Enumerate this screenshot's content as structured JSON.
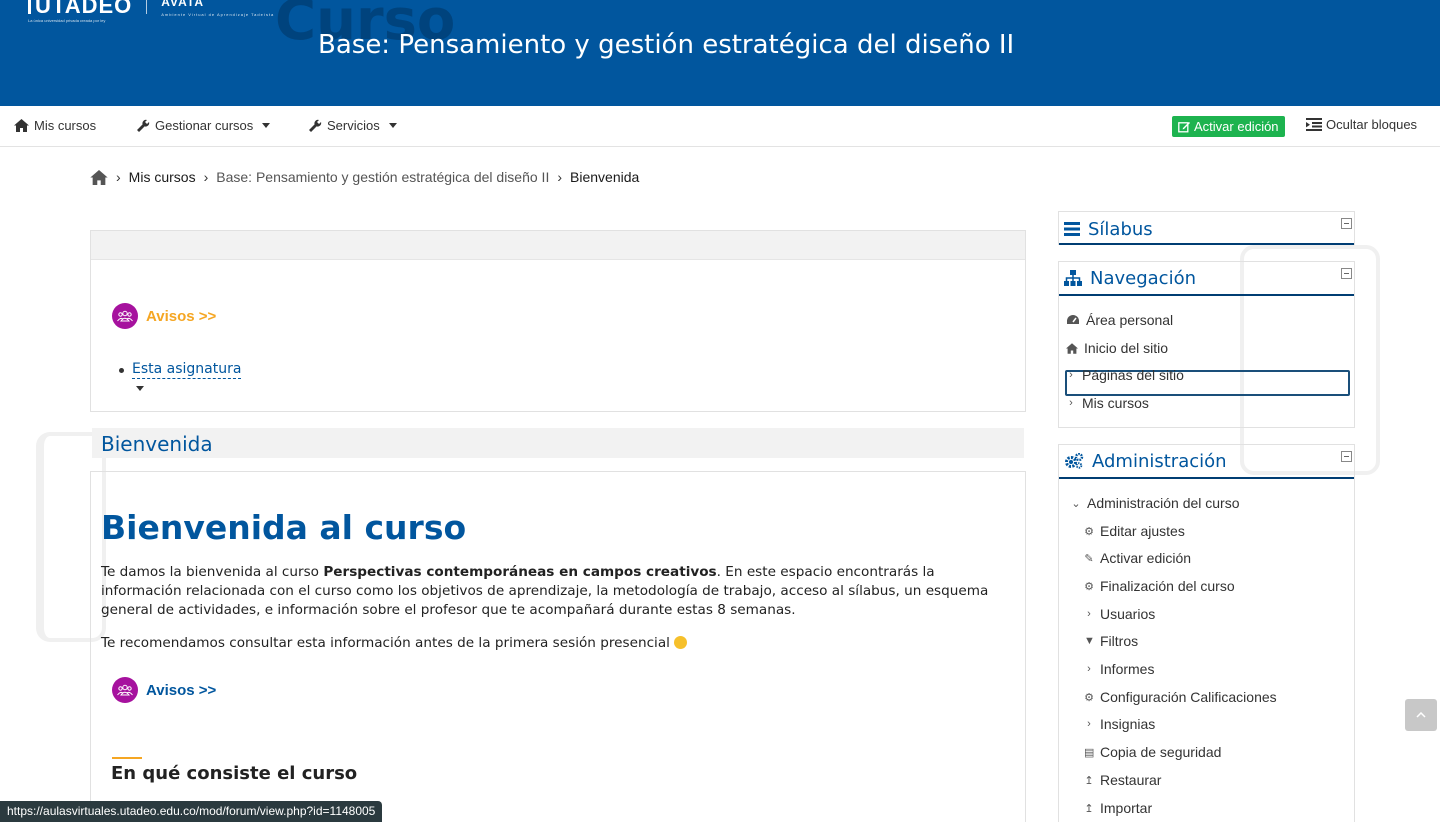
{
  "header": {
    "logo_main": "UTADEO",
    "logo_sub": "La única universidad privada creada por ley",
    "logo_avata": "AVATA",
    "logo_avata_sub": "Ambiente Virtual de Aprendizaje Tadeísta",
    "ghost_word": "Curso",
    "course_title": "Base: Pensamiento y gestión estratégica del diseño II"
  },
  "navbar": {
    "mis_cursos": "Mis cursos",
    "gestionar": "Gestionar cursos",
    "servicios": "Servicios",
    "activar_edicion": "Activar edición",
    "ocultar_bloques": "Ocultar bloques"
  },
  "breadcrumb": {
    "items": [
      "Mis cursos",
      "Base: Pensamiento y gestión estratégica del diseño II",
      "Bienvenida"
    ]
  },
  "main": {
    "avisos_label": "Avisos >>",
    "esta_asignatura": "Esta asignatura",
    "section_title": "Bienvenida",
    "welcome_heading": "Bienvenida al curso",
    "p1_pre": "Te damos la bienvenida al curso ",
    "p1_bold": "Perspectivas contemporáneas en campos creativos",
    "p1_post": ". En este espacio encontrarás la información relacionada con el curso como los objetivos de aprendizaje, la metodología de trabajo, acceso al sílabus, un esquema general de actividades, e información sobre el profesor que te acompañará durante estas 8 semanas.",
    "p2": "Te recomendamos consultar esta información antes de la primera sesión presencial",
    "avisos_label_2": "Avisos >>",
    "sub_heading": "En qué consiste el curso"
  },
  "blocks": {
    "silabus": {
      "title": "Sílabus"
    },
    "navegacion": {
      "title": "Navegación",
      "items": [
        "Área personal",
        "Inicio del sitio",
        "Páginas del sitio",
        "Mis cursos"
      ]
    },
    "administracion": {
      "title": "Administración",
      "items": [
        "Administración del curso",
        "Editar ajustes",
        "Activar edición",
        "Finalización del curso",
        "Usuarios",
        "Filtros",
        "Informes",
        "Configuración Calificaciones",
        "Insignias",
        "Copia de seguridad",
        "Restaurar",
        "Importar"
      ]
    }
  },
  "status_url": "https://aulasvirtuales.utadeo.edu.co/mod/forum/view.php?id=1148005",
  "colors": {
    "brand_blue": "#01569e",
    "edit_green": "#1db34f",
    "avisos_orange": "#f5a623",
    "avisos_purple": "#a6129e"
  }
}
